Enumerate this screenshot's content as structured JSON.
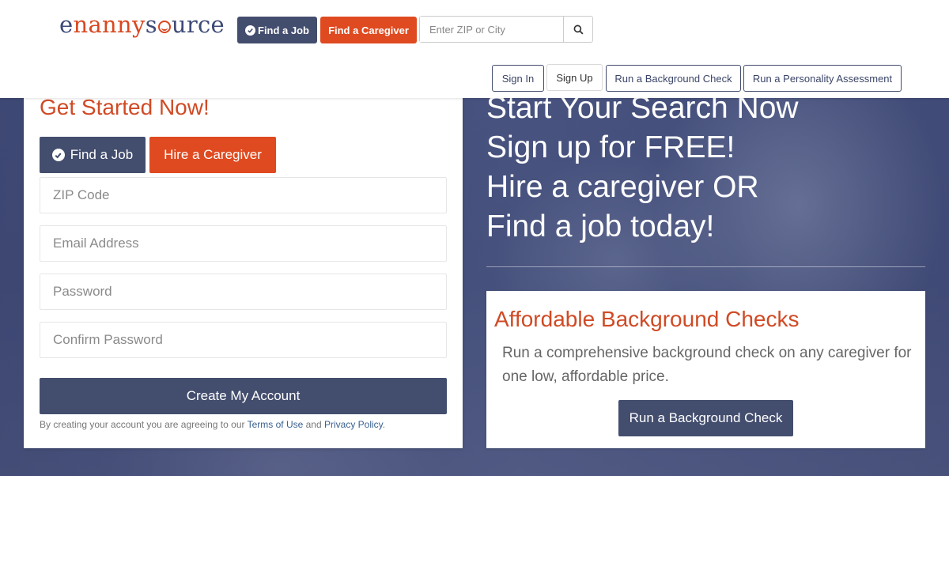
{
  "header": {
    "logo": {
      "part1": "e",
      "part2": "nanny",
      "part3": "s",
      "part4": "urce"
    },
    "find_job_label": "Find a Job",
    "find_caregiver_label": "Find a Caregiver",
    "search_placeholder": "Enter ZIP or City",
    "nav": {
      "sign_in": "Sign In",
      "sign_up": "Sign Up",
      "background_check": "Run a Background Check",
      "personality_assessment": "Run a Personality Assessment"
    }
  },
  "signup": {
    "title": "Get Started Now!",
    "tab_find_job": "Find a Job",
    "tab_hire_caregiver": "Hire a Caregiver",
    "zip_placeholder": "ZIP Code",
    "email_placeholder": "Email Address",
    "password_placeholder": "Password",
    "confirm_password_placeholder": "Confirm Password",
    "submit_label": "Create My Account",
    "legal_prefix": "By creating your account you are agreeing to our ",
    "terms_link": "Terms of Use",
    "legal_and": " and ",
    "privacy_link": "Privacy Policy",
    "legal_suffix": "."
  },
  "hero": {
    "lines": [
      "Start Your Search Now",
      "Sign up for FREE!",
      "Hire a caregiver OR",
      "Find a job today!"
    ]
  },
  "background_card": {
    "title": "Affordable Background Checks",
    "text": "Run a comprehensive background check on any caregiver for one low, affordable price.",
    "button_label": "Run a Background Check"
  },
  "colors": {
    "brand_navy": "#434d6e",
    "brand_orange": "#df4a20",
    "heading_orange": "#d04a25"
  },
  "icons": {
    "check": "check-circle-icon",
    "search": "search-icon"
  }
}
